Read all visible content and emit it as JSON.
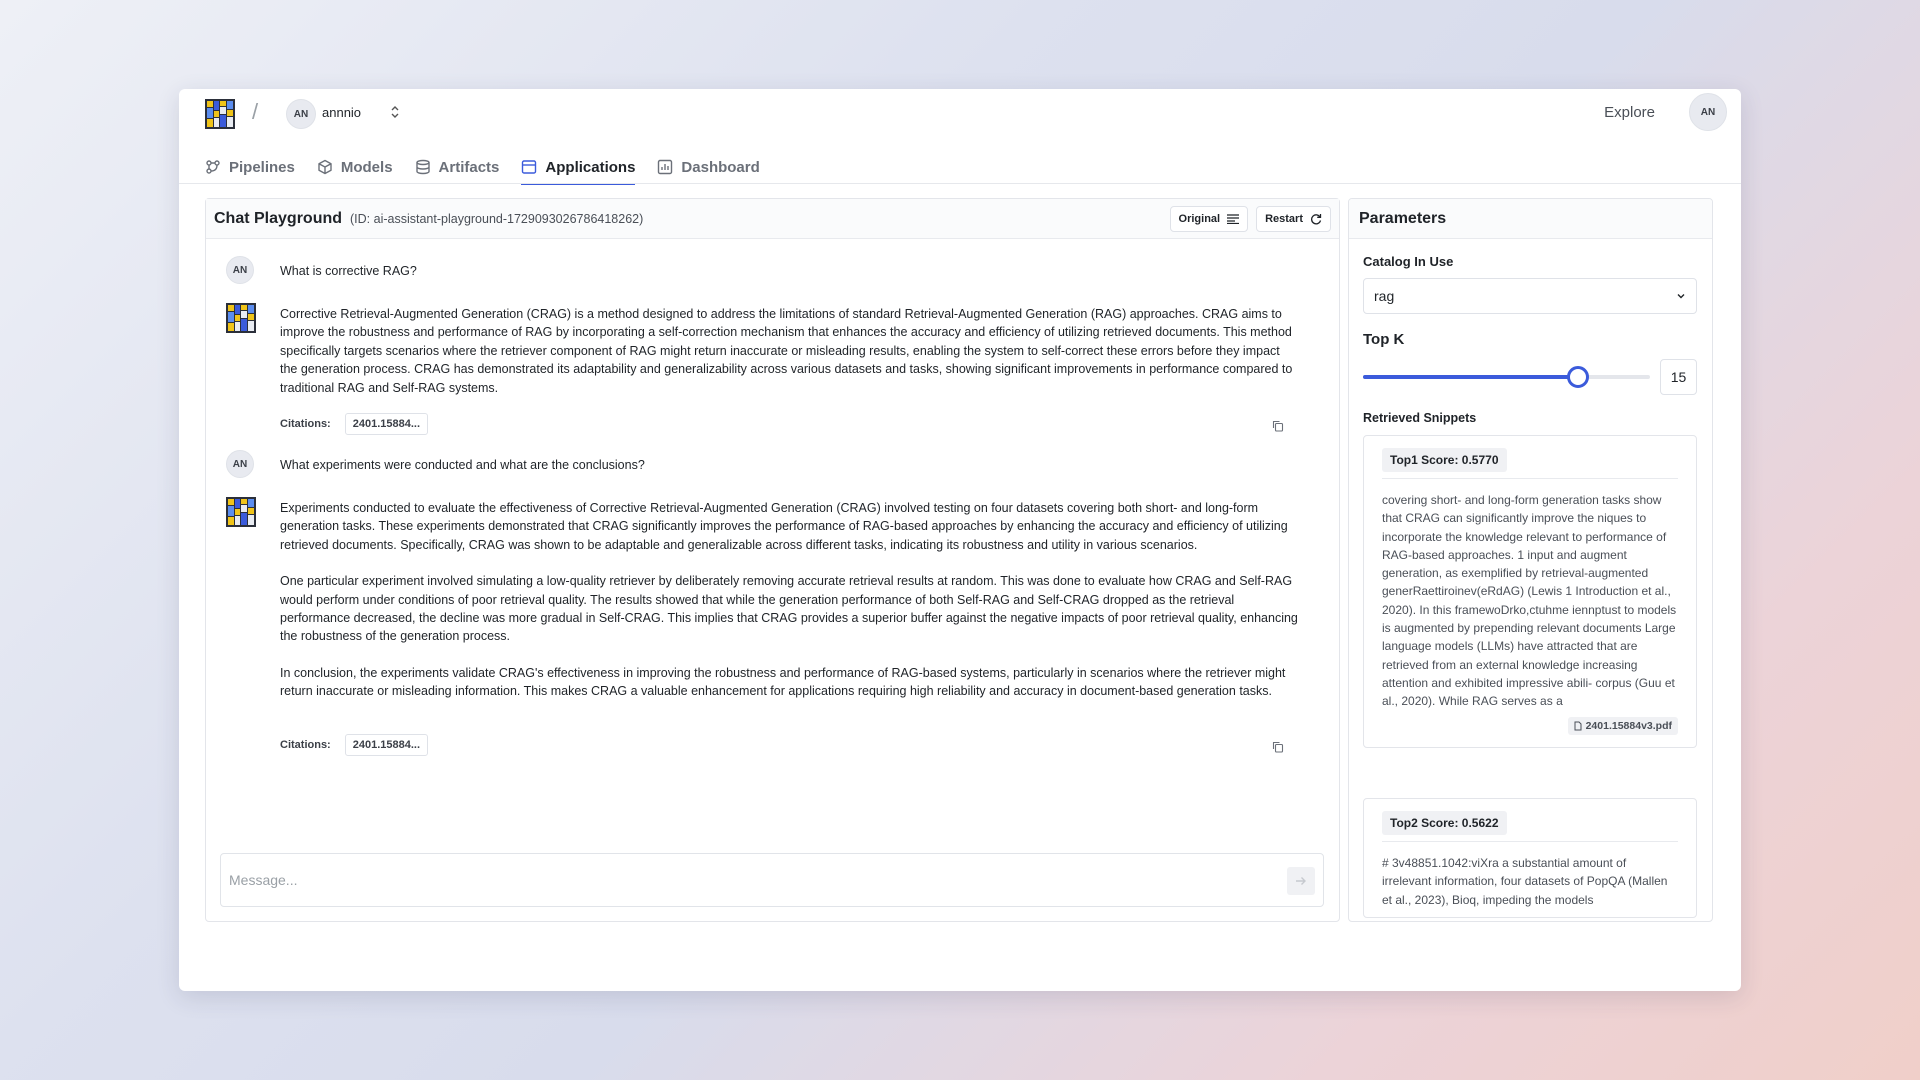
{
  "header": {
    "org_avatar": "AN",
    "org_name": "annnio",
    "explore": "Explore",
    "user_avatar": "AN"
  },
  "tabs": [
    {
      "label": "Pipelines",
      "icon": "pipeline-icon"
    },
    {
      "label": "Models",
      "icon": "cube-icon"
    },
    {
      "label": "Artifacts",
      "icon": "database-icon"
    },
    {
      "label": "Applications",
      "icon": "window-icon",
      "active": true
    },
    {
      "label": "Dashboard",
      "icon": "chart-icon"
    }
  ],
  "chat": {
    "title": "Chat Playground",
    "id": "(ID: ai-assistant-playground-1729093026786418262)",
    "original_label": "Original",
    "restart_label": "Restart",
    "messages": [
      {
        "role": "user",
        "avatar": "AN",
        "text": "What is corrective RAG?"
      },
      {
        "role": "assistant",
        "paragraphs": [
          "Corrective Retrieval-Augmented Generation (CRAG) is a method designed to address the limitations of standard Retrieval-Augmented Generation (RAG) approaches. CRAG aims to improve the robustness and performance of RAG by incorporating a self-correction mechanism that enhances the accuracy and efficiency of utilizing retrieved documents. This method specifically targets scenarios where the retriever component of RAG might return inaccurate or misleading results, enabling the system to self-correct these errors before they impact the generation process. CRAG has demonstrated its adaptability and generalizability across various datasets and tasks, showing significant improvements in performance compared to traditional RAG and Self-RAG systems."
        ],
        "citations_label": "Citations:",
        "citation": "2401.15884..."
      },
      {
        "role": "user",
        "avatar": "AN",
        "text": "What experiments were conducted and what are the conclusions?"
      },
      {
        "role": "assistant",
        "paragraphs": [
          "Experiments conducted to evaluate the effectiveness of Corrective Retrieval-Augmented Generation (CRAG) involved testing on four datasets covering both short- and long-form generation tasks. These experiments demonstrated that CRAG significantly improves the performance of RAG-based approaches by enhancing the accuracy and efficiency of utilizing retrieved documents. Specifically, CRAG was shown to be adaptable and generalizable across different tasks, indicating its robustness and utility in various scenarios.",
          "One particular experiment involved simulating a low-quality retriever by deliberately removing accurate retrieval results at random. This was done to evaluate how CRAG and Self-RAG would perform under conditions of poor retrieval quality. The results showed that while the generation performance of both Self-RAG and Self-CRAG dropped as the retrieval performance decreased, the decline was more gradual in Self-CRAG. This implies that CRAG provides a superior buffer against the negative impacts of poor retrieval quality, enhancing the robustness of the generation process.",
          "In conclusion, the experiments validate CRAG's effectiveness in improving the robustness and performance of RAG-based systems, particularly in scenarios where the retriever might return inaccurate or misleading information. This makes CRAG a valuable enhancement for applications requiring high reliability and accuracy in document-based generation tasks."
        ],
        "citations_label": "Citations:",
        "citation": "2401.15884..."
      }
    ],
    "input_placeholder": "Message..."
  },
  "params": {
    "title": "Parameters",
    "catalog_label": "Catalog In Use",
    "catalog_value": "rag",
    "topk_label": "Top K",
    "topk_value": "15",
    "topk_fraction": 0.75,
    "snippets_label": "Retrieved Snippets",
    "snippets": [
      {
        "score": "Top1 Score: 0.5770",
        "text": "covering short- and long-form generation tasks show that CRAG can significantly improve the niques to incorporate the knowledge relevant to performance of RAG-based approaches. 1 input and augment generation, as exemplified by retrieval-augmented generRaettiroinev(eRdAG) (Lewis 1 Introduction et al., 2020). In this framewoDrko,ctuhme iennptust to models is augmented by prepending relevant documents Large language models (LLMs) have attracted that are retrieved from an external knowledge increasing attention and exhibited impressive abili- corpus (Guu et al., 2020). While RAG serves as a",
        "file": "2401.15884v3.pdf"
      },
      {
        "score": "Top2 Score: 0.5622",
        "text": "# 3v48851.1042:viXra a substantial amount of irrelevant information, four datasets of PopQA (Mallen et al., 2023), Bioq, impeding the models"
      }
    ]
  },
  "colors": {
    "accent": "#3b5bdb"
  }
}
